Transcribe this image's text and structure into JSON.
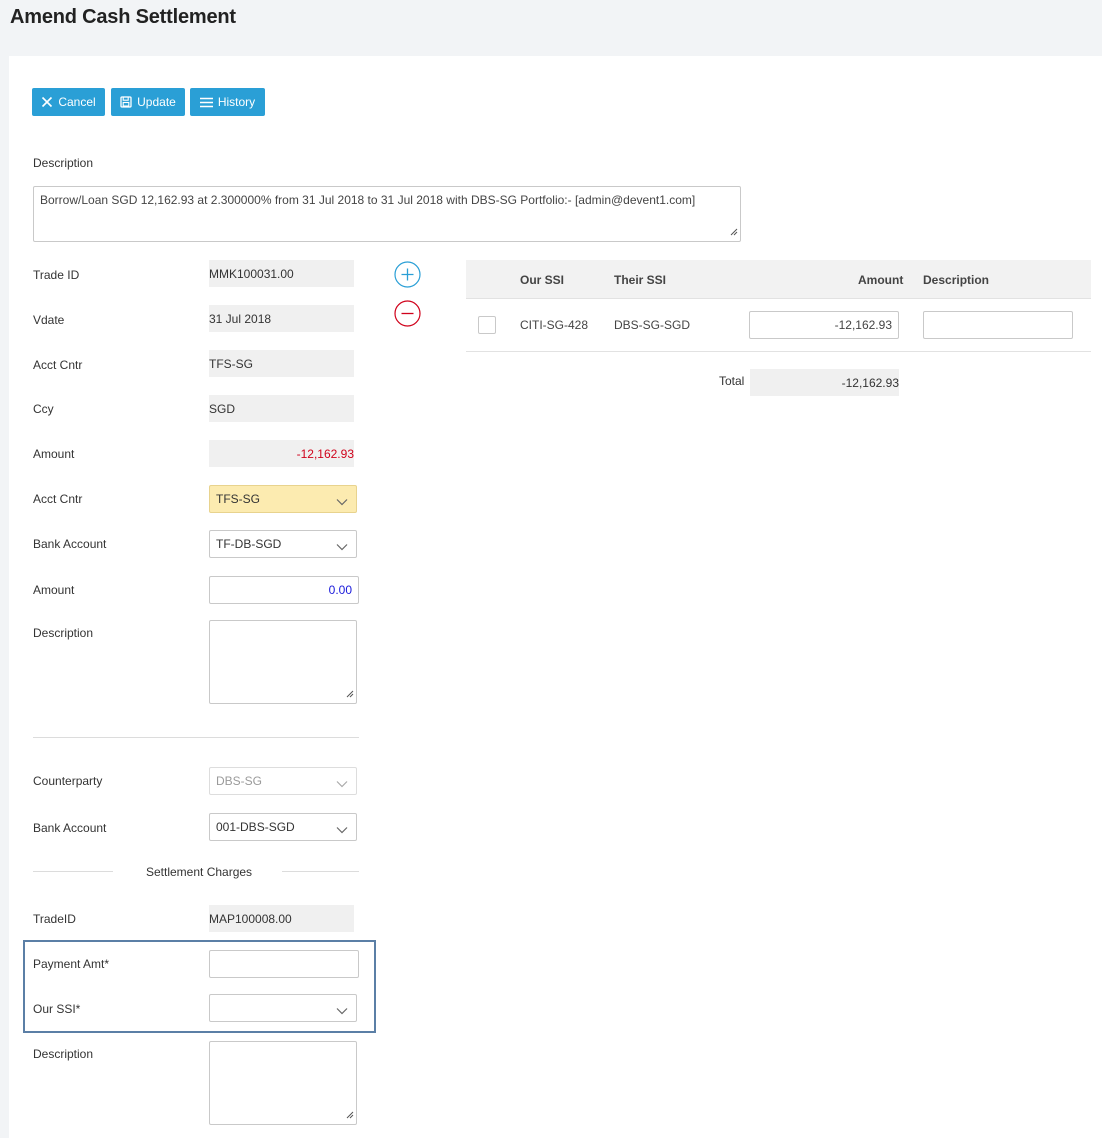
{
  "page": {
    "title": "Amend Cash Settlement"
  },
  "toolbar": {
    "cancel_label": "Cancel",
    "update_label": "Update",
    "history_label": "History"
  },
  "description": {
    "label": "Description",
    "value": "Borrow/Loan SGD 12,162.93 at 2.300000% from 31 Jul 2018 to 31 Jul 2018 with DBS-SG  Portfolio:- [admin@devent1.com]"
  },
  "trade": {
    "trade_id_label": "Trade ID",
    "trade_id": "MMK100031.00",
    "vdate_label": "Vdate",
    "vdate": "31 Jul 2018",
    "acct_cntr_label": "Acct Cntr",
    "acct_cntr": "TFS-SG",
    "ccy_label": "Ccy",
    "ccy": "SGD",
    "amount_label": "Amount",
    "amount": "-12,162.93"
  },
  "ours": {
    "acct_cntr_label": "Acct Cntr",
    "acct_cntr": "TFS-SG",
    "bank_account_label": "Bank Account",
    "bank_account": "TF-DB-SGD",
    "amount_label": "Amount",
    "amount": "0.00",
    "description_label": "Description"
  },
  "theirs": {
    "counterparty_label": "Counterparty",
    "counterparty": "DBS-SG",
    "bank_account_label": "Bank Account",
    "bank_account": "001-DBS-SGD"
  },
  "charges": {
    "section_label": "Settlement Charges",
    "trade_id_label": "TradeID",
    "trade_id": "MAP100008.00",
    "payment_amt_label": "Payment Amt*",
    "payment_amt": "",
    "our_ssi_label": "Our SSI*",
    "our_ssi": "",
    "description_label": "Description"
  },
  "ssi_table": {
    "headers": {
      "our_ssi": "Our SSI",
      "their_ssi": "Their SSI",
      "amount": "Amount",
      "description": "Description"
    },
    "rows": [
      {
        "our_ssi": "CITI-SG-428",
        "their_ssi": "DBS-SG-SGD",
        "amount": "-12,162.93",
        "description": ""
      }
    ],
    "total_label": "Total",
    "total": "-12,162.93"
  },
  "colors": {
    "primary": "#2a9fd6",
    "negative": "#d0021b",
    "positive_input": "#1a1adb",
    "highlight_select": "#fcebb0",
    "focus_box": "#5b7fa6"
  }
}
